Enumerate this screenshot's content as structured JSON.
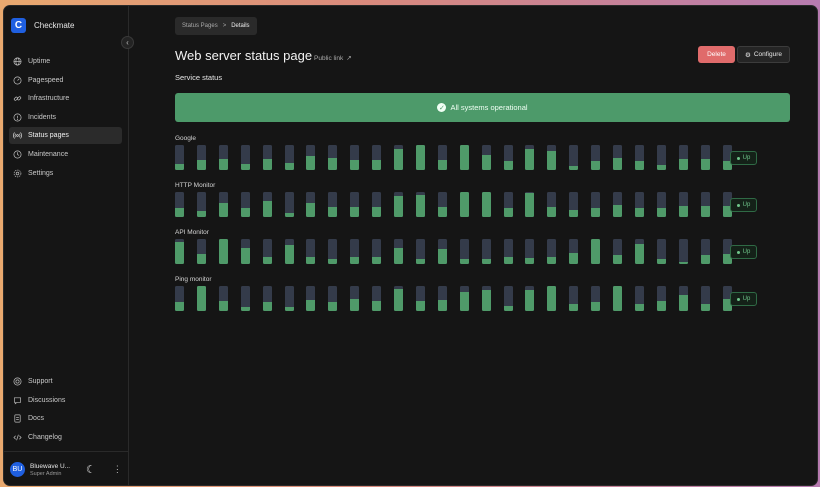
{
  "app": {
    "name": "Checkmate",
    "logo_letter": "C"
  },
  "sidebar": {
    "items": [
      {
        "label": "Uptime",
        "icon": "globe-icon"
      },
      {
        "label": "Pagespeed",
        "icon": "gauge-icon"
      },
      {
        "label": "Infrastructure",
        "icon": "link-icon"
      },
      {
        "label": "Incidents",
        "icon": "alert-circle-icon"
      },
      {
        "label": "Status pages",
        "icon": "broadcast-icon",
        "active": true
      },
      {
        "label": "Maintenance",
        "icon": "clock-icon"
      },
      {
        "label": "Settings",
        "icon": "gear-icon"
      }
    ],
    "bottom_items": [
      {
        "label": "Support",
        "icon": "lifebuoy-icon"
      },
      {
        "label": "Discussions",
        "icon": "chat-icon"
      },
      {
        "label": "Docs",
        "icon": "document-icon"
      },
      {
        "label": "Changelog",
        "icon": "code-icon"
      }
    ],
    "user": {
      "initials": "BU",
      "name": "Bluewave U...",
      "role": "Super Admin"
    }
  },
  "breadcrumb": {
    "parent": "Status Pages",
    "separator": ">",
    "current": "Details"
  },
  "header": {
    "title": "Web server status page",
    "public_link": "Public link",
    "delete_label": "Delete",
    "configure_label": "Configure"
  },
  "service_status_label": "Service status",
  "banner_text": "All systems operational",
  "colors": {
    "operational": "#4d9a6a",
    "delete": "#e06b6b",
    "bar_empty": "#343b4a",
    "bar_fill": "#4f9a69",
    "accent": "#1f5fe0"
  },
  "monitors": [
    {
      "name": "Google",
      "status": "Up",
      "bars": [
        0.25,
        0.4,
        0.45,
        0.25,
        0.45,
        0.3,
        0.55,
        0.5,
        0.4,
        0.4,
        0.85,
        1.0,
        0.4,
        1.0,
        0.6,
        0.35,
        0.85,
        0.75,
        0.15,
        0.35,
        0.5,
        0.35,
        0.2,
        0.45,
        0.45,
        0.35
      ]
    },
    {
      "name": "HTTP Monitor",
      "status": "Up",
      "bars": [
        0.35,
        0.25,
        0.55,
        0.35,
        0.65,
        0.15,
        0.55,
        0.4,
        0.4,
        0.4,
        0.85,
        0.9,
        0.4,
        1.0,
        1.0,
        0.35,
        0.95,
        0.4,
        0.3,
        0.35,
        0.5,
        0.35,
        0.35,
        0.45,
        0.45,
        0.45
      ]
    },
    {
      "name": "API Monitor",
      "status": "Up",
      "bars": [
        0.9,
        0.4,
        1.0,
        0.65,
        0.3,
        0.75,
        0.3,
        0.2,
        0.3,
        0.3,
        0.65,
        0.2,
        0.6,
        0.2,
        0.2,
        0.3,
        0.25,
        0.3,
        0.45,
        1.0,
        0.35,
        0.8,
        0.2,
        0.1,
        0.35,
        0.4
      ]
    },
    {
      "name": "Ping monitor",
      "status": "Up",
      "bars": [
        0.35,
        1.0,
        0.4,
        0.15,
        0.35,
        0.15,
        0.45,
        0.35,
        0.5,
        0.4,
        0.9,
        0.4,
        0.45,
        0.75,
        0.85,
        0.2,
        0.85,
        1.0,
        0.3,
        0.35,
        1.0,
        0.3,
        0.4,
        0.65,
        0.3,
        0.5
      ]
    }
  ]
}
